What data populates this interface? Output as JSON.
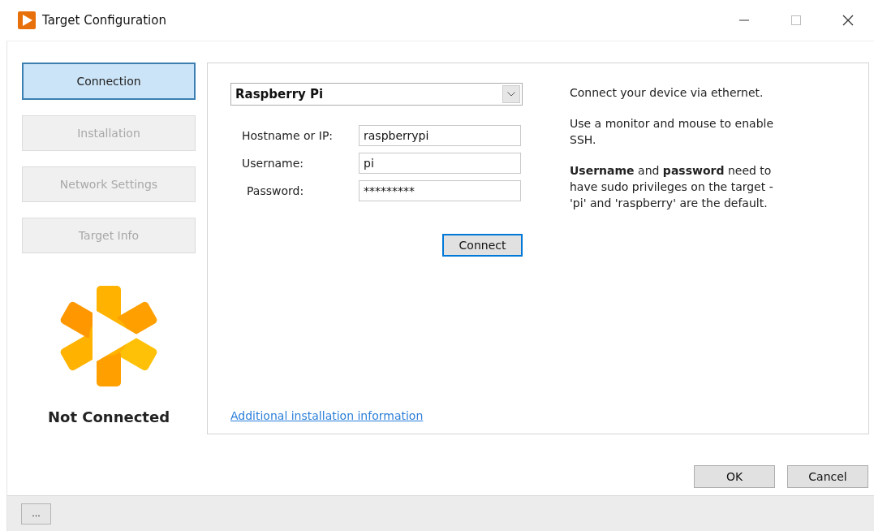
{
  "window": {
    "title": "Target Configuration"
  },
  "sidebar": {
    "items": [
      {
        "label": "Connection",
        "selected": true,
        "disabled": false
      },
      {
        "label": "Installation",
        "selected": false,
        "disabled": true
      },
      {
        "label": "Network Settings",
        "selected": false,
        "disabled": true
      },
      {
        "label": "Target Info",
        "selected": false,
        "disabled": true
      }
    ],
    "status": "Not Connected"
  },
  "connection": {
    "target_select": "Raspberry Pi",
    "fields": [
      {
        "label": "Hostname or IP:",
        "value": "raspberrypi"
      },
      {
        "label": "Username:",
        "value": "pi"
      },
      {
        "label": "Password:",
        "value": "*********"
      }
    ],
    "connect_button": "Connect",
    "link": "Additional installation information",
    "help": [
      "Connect your device via ethernet.",
      "Use a monitor and mouse to enable SSH.",
      "**Username** and **password** need to have sudo privileges on the target - 'pi' and 'raspberry' are the default."
    ]
  },
  "buttons": [
    "OK",
    "Cancel"
  ],
  "status_bar": {
    "button": "..."
  }
}
